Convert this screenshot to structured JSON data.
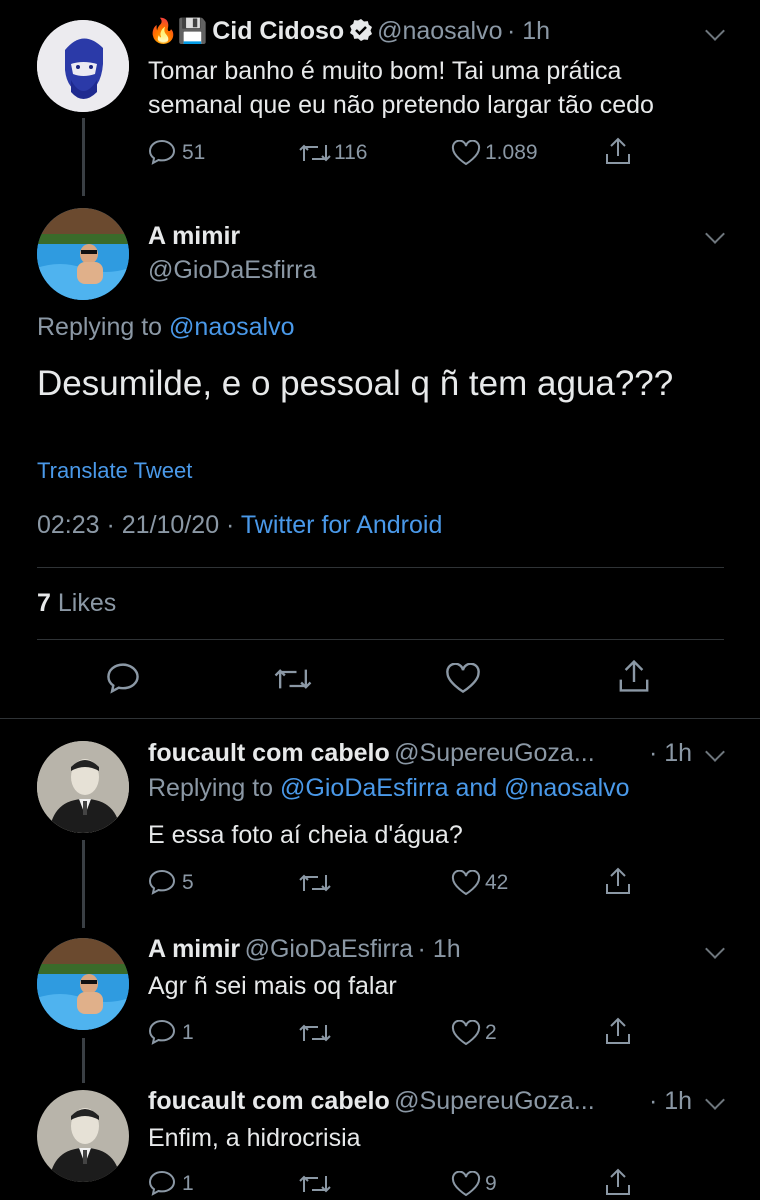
{
  "tweets": {
    "t1": {
      "emoji": "🔥💾",
      "name": "Cid Cidoso",
      "handle": "@naosalvo",
      "time": "· 1h",
      "text_line1": "Tomar banho é muito bom! Tai uma prática",
      "text_line2": "semanal que eu não pretendo largar tão cedo",
      "replies": "51",
      "retweets": "116",
      "likes": "1.089"
    },
    "main": {
      "name": "A mimir",
      "handle": "@GioDaEsfirra",
      "replying_prefix": "Replying to",
      "replying_to": "@naosalvo",
      "text": "Desumilde, e o pessoal q ñ tem agua???",
      "translate": "Translate Tweet",
      "datetime": "02:23 · 21/10/20 ·",
      "source": "Twitter for Android",
      "likes_count": "7",
      "likes_label": "Likes"
    },
    "t3": {
      "name": "foucault com cabelo",
      "handle": "@SupereuGoza...",
      "time": "· 1h",
      "replying_prefix": "Replying to",
      "replying_to": "@GioDaEsfirra and @naosalvo",
      "text": "E essa foto aí cheia d'água?",
      "replies": "5",
      "likes": "42"
    },
    "t4": {
      "name": "A mimir",
      "handle": "@GioDaEsfirra",
      "time": "· 1h",
      "text": "Agr ñ sei mais oq falar",
      "replies": "1",
      "likes": "2"
    },
    "t5": {
      "name": "foucault com cabelo",
      "handle": "@SupereuGoza...",
      "time": "· 1h",
      "text": "Enfim, a hidrocrisia",
      "replies": "1",
      "likes": "9"
    }
  },
  "colors": {
    "background": "#000000",
    "link": "#4a99e9",
    "muted": "#8b98a5",
    "text": "#e7e9ea"
  }
}
